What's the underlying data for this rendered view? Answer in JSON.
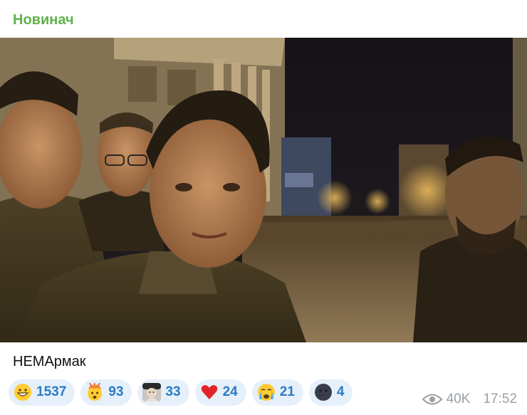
{
  "channel": {
    "name": "Новинач"
  },
  "post": {
    "caption": "НЕМАрмак",
    "views": "40K",
    "time": "17:52"
  },
  "reactions": [
    {
      "icon": "grinning-face-icon",
      "count": "1537"
    },
    {
      "icon": "exploding-head-icon",
      "count": "93"
    },
    {
      "icon": "custom-avatar-icon",
      "count": "33"
    },
    {
      "icon": "red-heart-icon",
      "count": "24"
    },
    {
      "icon": "crying-face-icon",
      "count": "21"
    },
    {
      "icon": "new-moon-face-icon",
      "count": "4"
    }
  ],
  "colors": {
    "channel_name": "#5fb04a",
    "reaction_bg": "#e6f0fa",
    "reaction_count": "#2a7bc4",
    "meta_text": "#9aa0a6"
  }
}
